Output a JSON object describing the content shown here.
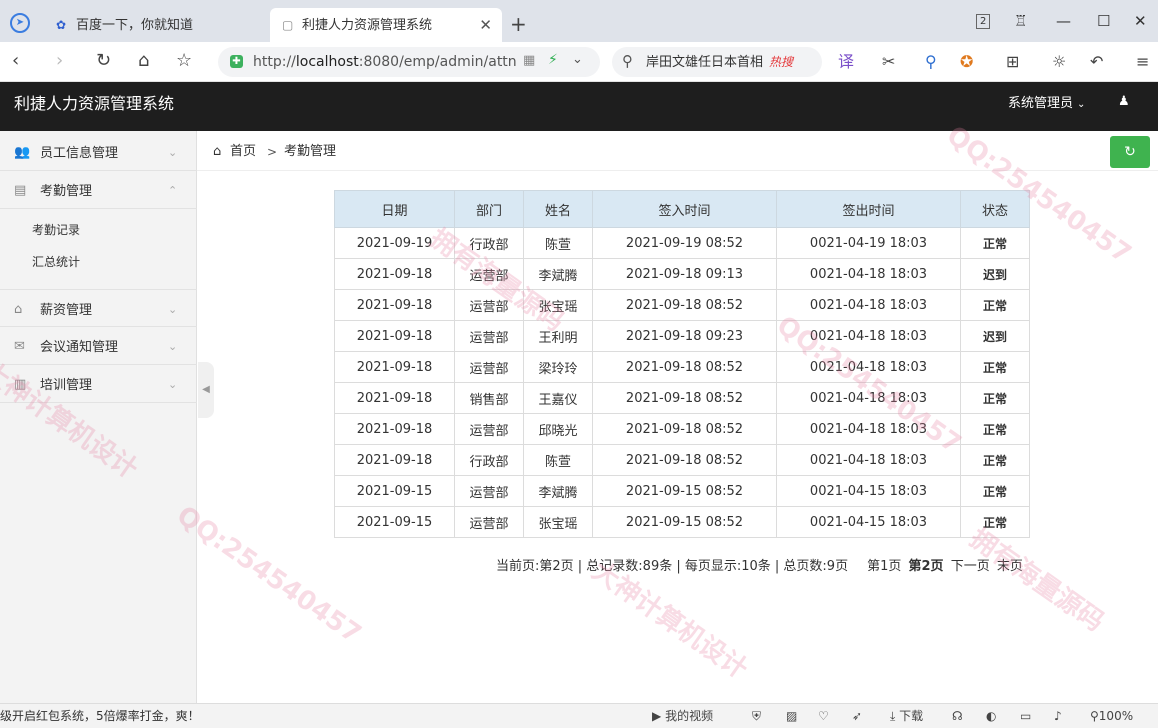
{
  "browser": {
    "tabs": [
      {
        "title": "百度一下，你就知道",
        "active": false
      },
      {
        "title": "利捷人力资源管理系统",
        "active": true
      }
    ],
    "tab_count": "2",
    "url_prefix": "http://",
    "url_host": "localhost",
    "url_rest": ":8080/emp/admin/attn",
    "search_text": "岸田文雄任日本首相",
    "search_badge": "热搜"
  },
  "app": {
    "title": "利捷人力资源管理系统",
    "user": "系统管理员"
  },
  "sidebar": {
    "items": [
      {
        "label": "员工信息管理",
        "icon": "users-icon"
      },
      {
        "label": "考勤管理",
        "icon": "clipboard-icon",
        "expanded": true
      },
      {
        "label": "薪资管理",
        "icon": "bank-icon"
      },
      {
        "label": "会议通知管理",
        "icon": "envelope-icon"
      },
      {
        "label": "培训管理",
        "icon": "book-icon"
      }
    ],
    "sub_items": [
      "考勤记录",
      "汇总统计"
    ]
  },
  "breadcrumb": {
    "home": "首页",
    "separator": ">",
    "current": "考勤管理"
  },
  "table": {
    "headers": [
      "日期",
      "部门",
      "姓名",
      "签入时间",
      "签出时间",
      "状态"
    ],
    "rows": [
      [
        "2021-09-19",
        "行政部",
        "陈萱",
        "2021-09-19 08:52",
        "0021-04-19 18:03",
        "正常"
      ],
      [
        "2021-09-18",
        "运营部",
        "李斌腾",
        "2021-09-18 09:13",
        "0021-04-18 18:03",
        "迟到"
      ],
      [
        "2021-09-18",
        "运营部",
        "张宝瑶",
        "2021-09-18 08:52",
        "0021-04-18 18:03",
        "正常"
      ],
      [
        "2021-09-18",
        "运营部",
        "王利明",
        "2021-09-18 09:23",
        "0021-04-18 18:03",
        "迟到"
      ],
      [
        "2021-09-18",
        "运营部",
        "梁玲玲",
        "2021-09-18 08:52",
        "0021-04-18 18:03",
        "正常"
      ],
      [
        "2021-09-18",
        "销售部",
        "王嘉仪",
        "2021-09-18 08:52",
        "0021-04-18 18:03",
        "正常"
      ],
      [
        "2021-09-18",
        "运营部",
        "邱晓光",
        "2021-09-18 08:52",
        "0021-04-18 18:03",
        "正常"
      ],
      [
        "2021-09-18",
        "行政部",
        "陈萱",
        "2021-09-18 08:52",
        "0021-04-18 18:03",
        "正常"
      ],
      [
        "2021-09-15",
        "运营部",
        "李斌腾",
        "2021-09-15 08:52",
        "0021-04-15 18:03",
        "正常"
      ],
      [
        "2021-09-15",
        "运营部",
        "张宝瑶",
        "2021-09-15 08:52",
        "0021-04-15 18:03",
        "正常"
      ]
    ]
  },
  "pagination": {
    "summary": "当前页:第2页 | 总记录数:89条 | 每页显示:10条 | 总页数:9页",
    "first_page": "第1页",
    "current_page": "第2页",
    "next": "下一页",
    "last": "末页"
  },
  "statusbar": {
    "text": "级开启红包系统，5倍爆率打金，爽！",
    "video": "我的视频",
    "download": "下载",
    "zoom": "100%"
  },
  "watermark": {
    "texts": [
      "大神计算机设计",
      "QQ:254540457",
      "拥有海量源码"
    ]
  }
}
